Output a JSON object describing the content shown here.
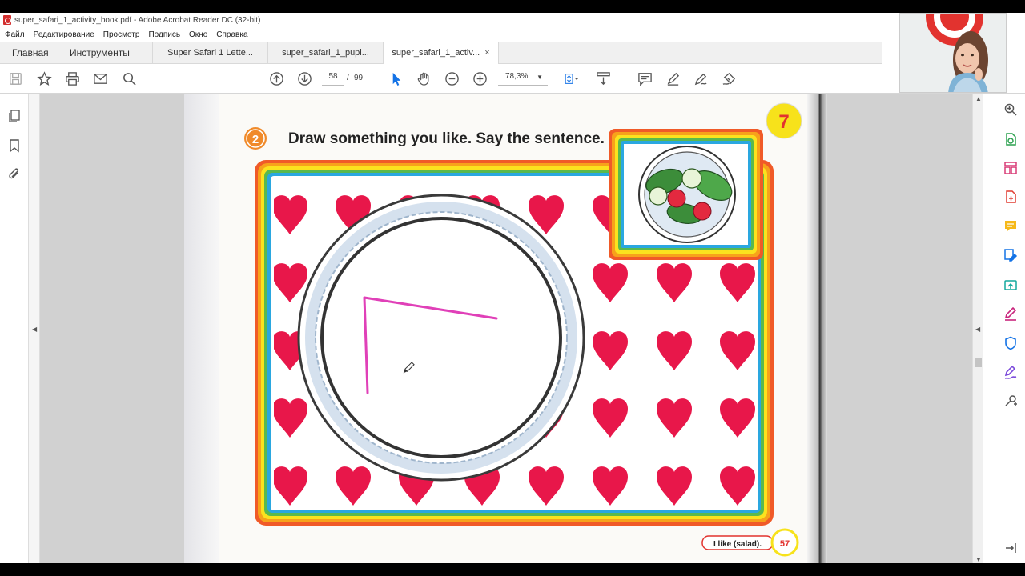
{
  "window": {
    "title": "super_safari_1_activity_book.pdf - Adobe Acrobat Reader DC (32-bit)"
  },
  "menu": [
    "Файл",
    "Редактирование",
    "Просмотр",
    "Подпись",
    "Окно",
    "Справка"
  ],
  "tabs": {
    "home": "Главная",
    "tools": "Инструменты",
    "documents": [
      {
        "label": "Super Safari 1 Lette..."
      },
      {
        "label": "super_safari_1_pupi..."
      },
      {
        "label": "super_safari_1_activ...",
        "active": true
      }
    ],
    "close_glyph": "×"
  },
  "toolbar": {
    "page_current": "58",
    "page_separator": "/",
    "page_total": "99",
    "zoom": "78,3%"
  },
  "page": {
    "task_number": "2",
    "instruction": "Draw something you like. Say the sentence.",
    "unit_badge": "7",
    "sentence_label": "I like (salad).",
    "page_number": "57"
  },
  "colors": {
    "heart": "#e8174a",
    "pen_stroke": "#e040b8",
    "badge_yellow": "#f7e21b",
    "badge_red": "#e2332f",
    "task_orange": "#f08a2a",
    "plate_ring": "#c9d6e6"
  }
}
